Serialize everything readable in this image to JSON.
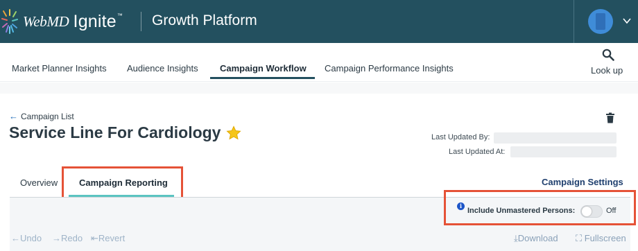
{
  "header": {
    "brand_webmd": "WebMD",
    "brand_ignite": "Ignite",
    "brand_tm": "™",
    "platform_title": "Growth Platform",
    "colors": {
      "background": "#23505f",
      "avatar": "#3f8cd8"
    }
  },
  "nav": {
    "items": [
      {
        "label": "Market Planner Insights"
      },
      {
        "label": "Audience Insights"
      },
      {
        "label": "Campaign Workflow",
        "active": true
      },
      {
        "label": "Campaign Performance Insights"
      }
    ],
    "lookup_label": "Look up",
    "lookup_icon": "search-icon"
  },
  "campaign": {
    "back_label": "Campaign List",
    "title": "Service Line For Cardiology",
    "favorite_icon": "star-icon",
    "delete_icon": "trash-icon",
    "last_updated_by_label": "Last Updated By:",
    "last_updated_at_label": "Last Updated At:"
  },
  "tabs": {
    "items": [
      {
        "label": "Overview"
      },
      {
        "label": "Campaign Reporting",
        "active": true
      }
    ],
    "settings_label": "Campaign Settings"
  },
  "panel": {
    "info_glyph": "i",
    "include_label": "Include Unmastered Persons:",
    "toggle_state": "Off",
    "toggle_on": false
  },
  "toolbar": {
    "undo_label": "←Undo",
    "redo_label": "→Redo",
    "revert_label": "⇤Revert",
    "download_label": "⤓Download",
    "fullscreen_label": "⛶ Fullscreen"
  },
  "colors": {
    "highlight": "#e55237",
    "tab_underline": "#5bc4c1",
    "nav_underline": "#23505f",
    "link": "#1f3f6e"
  }
}
